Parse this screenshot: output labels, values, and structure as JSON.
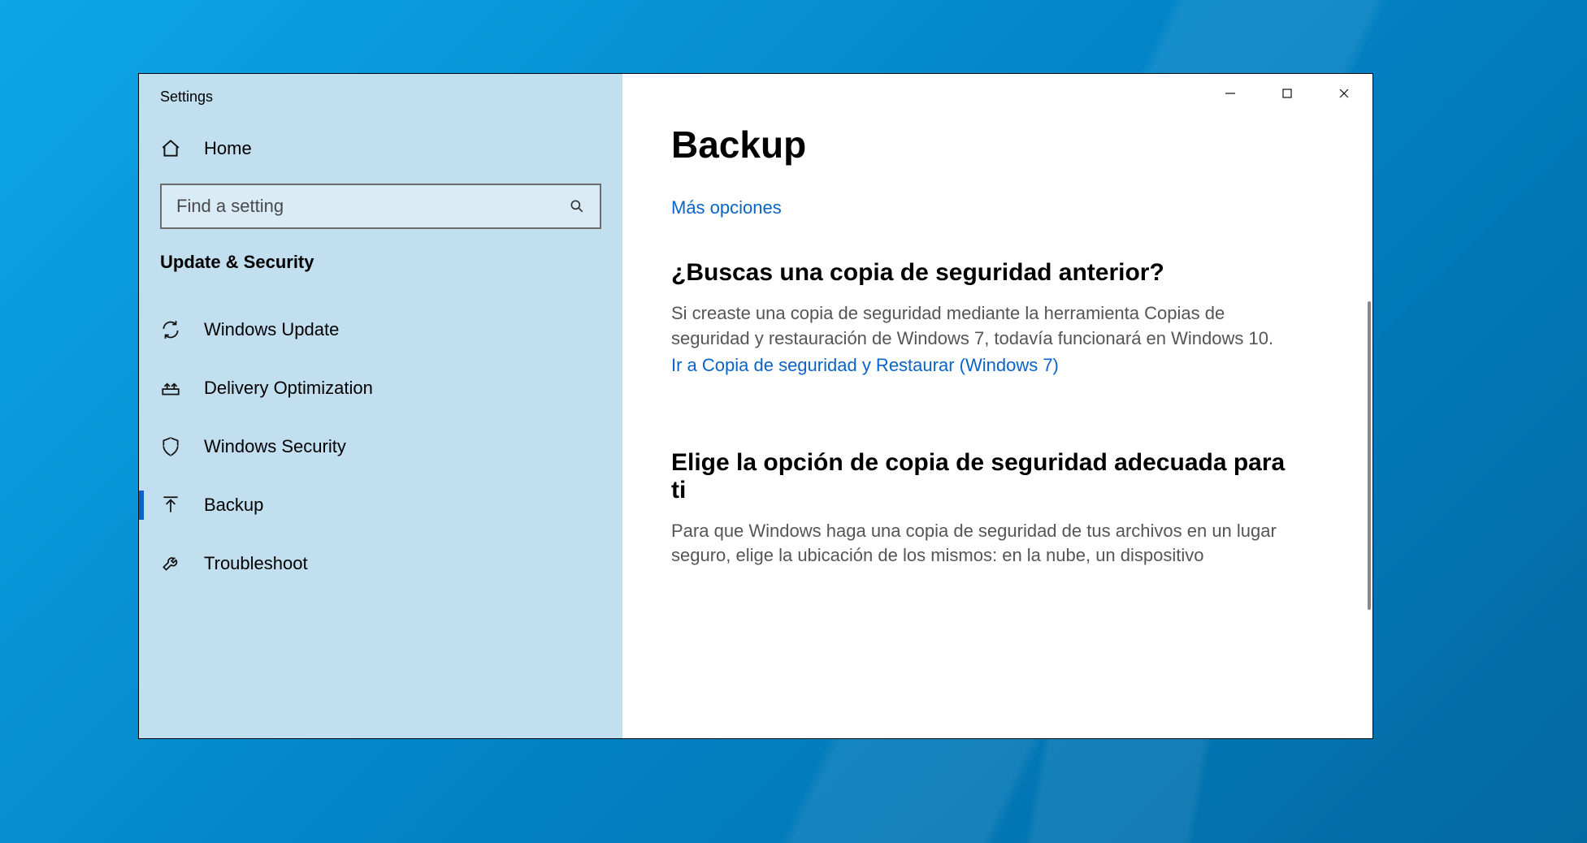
{
  "app_title": "Settings",
  "sidebar": {
    "home_label": "Home",
    "search_placeholder": "Find a setting",
    "category": "Update & Security",
    "items": [
      {
        "icon": "sync-icon",
        "label": "Windows Update",
        "active": false
      },
      {
        "icon": "delivery-icon",
        "label": "Delivery Optimization",
        "active": false
      },
      {
        "icon": "shield-icon",
        "label": "Windows Security",
        "active": false
      },
      {
        "icon": "backup-icon",
        "label": "Backup",
        "active": true
      },
      {
        "icon": "troubleshoot-icon",
        "label": "Troubleshoot",
        "active": false
      }
    ]
  },
  "content": {
    "title": "Backup",
    "more_options_link": "Más opciones",
    "section1": {
      "heading": "¿Buscas una copia de seguridad anterior?",
      "body": "Si creaste una copia de seguridad mediante la herramienta Copias de seguridad y restauración de Windows 7, todavía funcionará en Windows 10.",
      "link": "Ir a Copia de seguridad y Restaurar (Windows 7)"
    },
    "section2": {
      "heading": "Elige la opción de copia de seguridad adecuada para ti",
      "body": "Para que Windows haga una copia de seguridad de tus archivos en un lugar seguro, elige la ubicación de los mismos: en la nube, un dispositivo"
    }
  },
  "window_controls": {
    "minimize": "Minimize",
    "maximize": "Maximize",
    "close": "Close"
  }
}
